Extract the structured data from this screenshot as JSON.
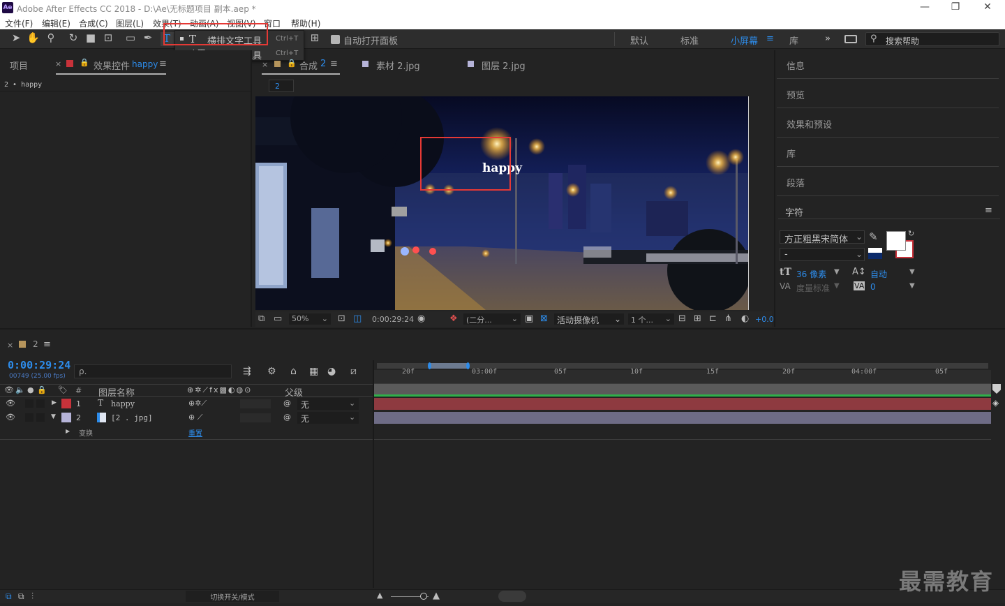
{
  "window": {
    "app_logo": "Ae",
    "title": "Adobe After Effects CC 2018 - D:\\Ae\\无标题项目 副本.aep *",
    "minimize": "—",
    "restore": "❐",
    "close": "✕"
  },
  "menu": [
    "文件(F)",
    "编辑(E)",
    "合成(C)",
    "图层(L)",
    "效果(T)",
    "动画(A)",
    "视图(V)",
    "窗口",
    "帮助(H)"
  ],
  "toolbar": {
    "auto_open_panel": "自动打开面板",
    "workspaces": [
      "默认",
      "标准",
      "小屏幕",
      "库"
    ],
    "active_workspace": "小屏幕",
    "more": "»",
    "search_placeholder": "搜索帮助"
  },
  "type_menu": {
    "items": [
      {
        "label": "横排文字工具",
        "shortcut": "Ctrl+T",
        "icon": "T",
        "selected": true
      },
      {
        "label": "直排文字工具",
        "shortcut": "Ctrl+T",
        "icon": "↓T",
        "selected": false
      }
    ]
  },
  "left_panel": {
    "tab_project": "项目",
    "tab_effects": "效果控件",
    "effects_layer": "happy",
    "breadcrumb": "2 • happy"
  },
  "comp_panel": {
    "tabs": [
      {
        "label": "合成",
        "suffix": "2"
      },
      {
        "label": "素材 2.jpg",
        "suffix": ""
      },
      {
        "label": "图层 2.jpg",
        "suffix": ""
      }
    ],
    "sub_tab": "2",
    "viewer_text": "happy",
    "footer": {
      "zoom": "50%",
      "timecode": "0:00:29:24",
      "resolution": "(二分...",
      "camera": "活动摄像机",
      "views": "1 个...",
      "exposure": "+0.0"
    }
  },
  "right_panel": {
    "sections": [
      "信息",
      "预览",
      "效果和预设",
      "库",
      "段落"
    ],
    "character": {
      "title": "字符",
      "font": "方正粗黑宋简体",
      "font_style": "-",
      "size": "36 像素",
      "leading": "自动",
      "kerning": "度量标准",
      "tracking": "0",
      "fill_color": "#ffffff"
    }
  },
  "timeline": {
    "comp_name": "2",
    "timecode": "0:00:29:24",
    "frame_info": "00749 (25.00 fps)",
    "search_placeholder": "ρ.",
    "col_num": "#",
    "col_name": "图层名称",
    "col_parent": "父级",
    "layers": [
      {
        "num": "1",
        "name": "happy",
        "parent": "无",
        "color": "#c8323a",
        "type": "T",
        "bar_color": "#8e3a40"
      },
      {
        "num": "2",
        "name": "[2 . jpg]",
        "parent": "无",
        "color": "#b6b4d9",
        "type": "img",
        "bar_color": "#6e6c86"
      }
    ],
    "transform_label": "变换",
    "transform_reset": "重置",
    "ruler": [
      "20f",
      "03:00f",
      "05f",
      "10f",
      "15f",
      "20f",
      "04:00f",
      "05f"
    ],
    "footer_toggle": "切换开关/模式"
  },
  "watermark": "最需教育"
}
